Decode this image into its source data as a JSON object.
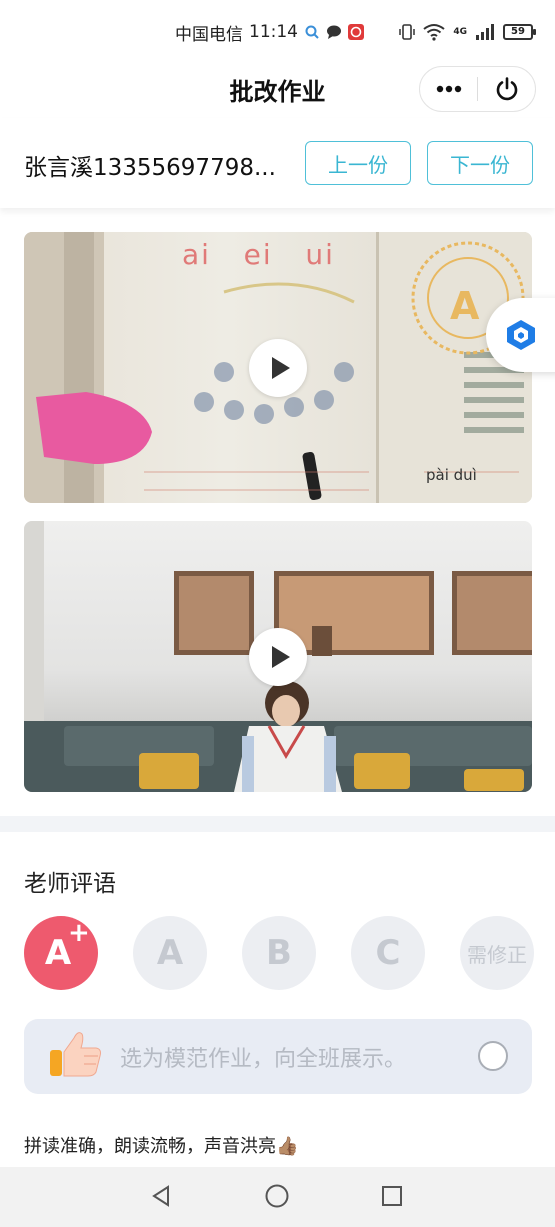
{
  "status_bar": {
    "carrier": "中国电信",
    "time": "11:14",
    "battery": "59",
    "network": "4G"
  },
  "header": {
    "title": "批改作业"
  },
  "student": {
    "name": "张言溪13355697798...",
    "prev_label": "上一份",
    "next_label": "下一份"
  },
  "media": {
    "item1": {
      "text_top": "ai   ei   ui",
      "text_bottom": "pài duì",
      "badge": "A"
    }
  },
  "review": {
    "section_title": "老师评语",
    "grades": [
      "A",
      "A",
      "B",
      "C",
      "需修正"
    ],
    "grade_plus": "+",
    "selected_index": 0,
    "feature_text": "选为模范作业，向全班展示。",
    "comment": "拼读准确，朗读流畅，声音洪亮👍🏽"
  },
  "colors": {
    "accent": "#4fc0d8",
    "grade_active": "#ee5a6e",
    "grade_inactive": "#eceef2"
  },
  "icons": [
    "search-icon",
    "chat-icon",
    "app-icon",
    "more-icon",
    "power-icon",
    "play-icon",
    "thumbs-up-icon",
    "back-icon",
    "home-icon",
    "recents-icon"
  ]
}
